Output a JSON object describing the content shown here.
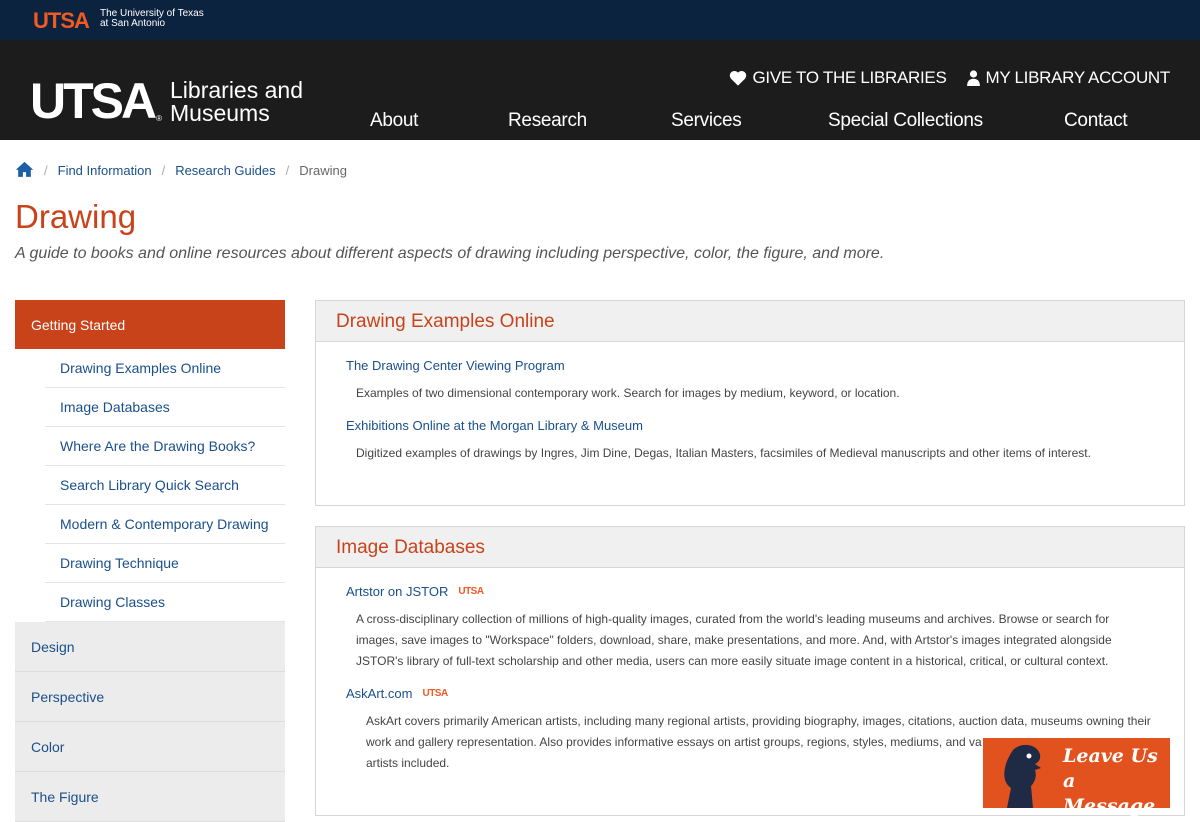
{
  "topbar": {
    "logo": "UTSA",
    "university_line1": "The University of Texas",
    "university_line2": "at San Antonio"
  },
  "header": {
    "brand_mark": "UTSA",
    "brand_reg": "®",
    "brand_line1": "Libraries and",
    "brand_line2": "Museums",
    "give_label": "GIVE TO THE LIBRARIES",
    "account_label": "MY LIBRARY ACCOUNT",
    "nav": [
      "About",
      "Research",
      "Services",
      "Special Collections",
      "Contact"
    ]
  },
  "breadcrumb": {
    "items": [
      "Find Information",
      "Research Guides"
    ],
    "current": "Drawing"
  },
  "page": {
    "title": "Drawing",
    "subtitle": "A guide to books and online resources about different aspects of drawing including perspective, color, the figure, and more."
  },
  "sidebar": {
    "active": "Getting Started",
    "subitems": [
      "Drawing Examples Online",
      "Image Databases",
      "Where Are the Drawing Books?",
      "Search Library Quick Search",
      "Modern & Contemporary Drawing",
      "Drawing Technique",
      "Drawing Classes"
    ],
    "top_items": [
      "Design",
      "Perspective",
      "Color",
      "The Figure"
    ]
  },
  "boxes": {
    "examples": {
      "heading": "Drawing Examples Online",
      "items": [
        {
          "title": "The Drawing Center Viewing Program",
          "desc": "Examples of two dimensional contemporary work. Search for images by medium, keyword, or location."
        },
        {
          "title": "Exhibitions Online at the Morgan Library & Museum",
          "desc": "Digitized examples of drawings by Ingres, Jim Dine, Degas, Italian Masters, facsimiles of Medieval manuscripts and other items of interest."
        }
      ]
    },
    "databases": {
      "heading": "Image Databases",
      "badge": "UTSA",
      "items": [
        {
          "title": "Artstor on JSTOR",
          "desc1": "A cross-disciplinary collection of millions of high-quality images, curated from the world's leading museums and archives. Browse or search for",
          "desc2": "images, save images to \"Workspace\" folders, download, share, make presentations, and more. And, with Artstor's images integrated alongside",
          "desc3": "JSTOR's library of full-text scholarship and other media, users can more easily situate image content in a historical, critical, or cultural context."
        },
        {
          "title": "AskArt.com",
          "desc1": "AskArt covers primarily American artists, including many regional artists, providing biography, images, citations, auction data, museums owning their",
          "desc2": "work and gallery representation. Also provides informative essays on artist groups, regions, styles, mediums, and va",
          "desc3": "artists included."
        }
      ]
    }
  },
  "chat": {
    "line1": "Leave Us",
    "line2": "a Message"
  },
  "colors": {
    "navy": "#0c2340",
    "orange": "#c8431a",
    "link": "#1a4f8b",
    "header": "#1c1c1c"
  }
}
